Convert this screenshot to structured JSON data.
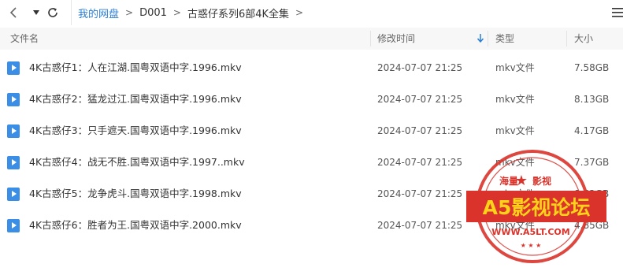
{
  "nav": {
    "back_icon": "chevron-left-icon",
    "history_icon": "dropdown-triangle-icon",
    "refresh_icon": "refresh-icon",
    "view_icon": "list-view-icon"
  },
  "breadcrumb": {
    "items": [
      "我的网盘",
      "D001",
      "古惑仔系列6部4K全集"
    ],
    "separator": ">"
  },
  "columns": {
    "name": "文件名",
    "date": "修改时间",
    "type": "类型",
    "size": "大小",
    "sort_icon": "arrow-down-icon"
  },
  "files": [
    {
      "name": "4K古惑仔1：人在江湖.国粤双语中字.1996.mkv",
      "date": "2024-07-07 21:25",
      "type": "mkv文件",
      "size": "7.58GB"
    },
    {
      "name": "4K古惑仔2：猛龙过江.国粤双语中字.1996.mkv",
      "date": "2024-07-07 21:25",
      "type": "mkv文件",
      "size": "8.13GB"
    },
    {
      "name": "4K古惑仔3：只手遮天.国粤双语中字.1996.mkv",
      "date": "2024-07-07 21:25",
      "type": "mkv文件",
      "size": "4.17GB"
    },
    {
      "name": "4K古惑仔4：战无不胜.国粤双语中字.1997..mkv",
      "date": "2024-07-07 21:25",
      "type": "mkv文件",
      "size": "7.37GB"
    },
    {
      "name": "4K古惑仔5：龙争虎斗.国粤双语中字.1998.mkv",
      "date": "2024-07-07 21:25",
      "type": "mkv文件",
      "size": "8.62GB"
    },
    {
      "name": "4K古惑仔6：胜者为王.国粤双语中字.2000.mkv",
      "date": "2024-07-07 21:25",
      "type": "mkv文件",
      "size": "4.85GB"
    }
  ],
  "watermark": {
    "top_left": "海量",
    "top_right": "影视",
    "main": "A5影视论坛",
    "url": "WWW.A5LT.COM",
    "colors": {
      "red": "#d9332b",
      "yellow": "#ffd21a"
    }
  },
  "colors": {
    "link": "#2b7fd3",
    "file_icon": "#3a8ee6",
    "header_bg": "#f7f7f7"
  }
}
